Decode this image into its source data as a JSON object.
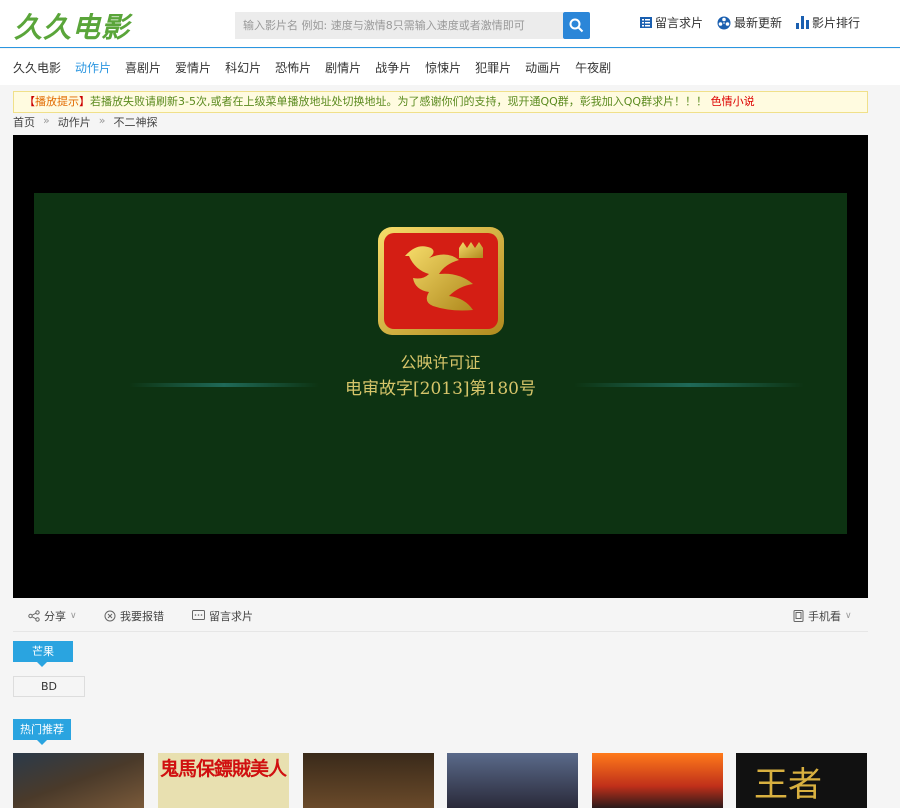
{
  "header": {
    "logo": "久久电影",
    "search_placeholder": "输入影片名 例如: 速度与激情8只需输入速度或者激情即可",
    "links": [
      {
        "label": "留言求片",
        "icon": "list-icon"
      },
      {
        "label": "最新更新",
        "icon": "film-reel-icon"
      },
      {
        "label": "影片排行",
        "icon": "bar-chart-icon"
      }
    ]
  },
  "nav": {
    "items": [
      "久久电影",
      "动作片",
      "喜剧片",
      "爱情片",
      "科幻片",
      "恐怖片",
      "剧情片",
      "战争片",
      "惊悚片",
      "犯罪片",
      "动画片",
      "午夜剧"
    ],
    "active": "动作片"
  },
  "notice": {
    "tag": "播放提示",
    "message": "若播放失败请刷新3-5次,或者在上级菜单播放地址处切换地址。为了感谢你们的支持，现开通QQ群，彰我加入QQ群求片！！！",
    "link": "色情小说"
  },
  "breadcrumb": {
    "items": [
      "首页",
      "动作片",
      "不二神探"
    ],
    "separator": "»"
  },
  "player": {
    "cert_line1": "公映许可证",
    "cert_line2": "电审故字[2013]第180号"
  },
  "toolbar": {
    "share": "分享",
    "report": "我要报错",
    "request": "留言求片",
    "mobile": "手机看"
  },
  "sources": {
    "title": "芒果",
    "buttons": [
      "BD"
    ]
  },
  "hot": {
    "title": "热门推荐",
    "poster2_text": "鬼馬保鏢賊美人",
    "poster6_text": "王者"
  },
  "colors": {
    "accent": "#2b96e0",
    "logo": "#5aa53a",
    "tag": "#2aa4e0"
  }
}
